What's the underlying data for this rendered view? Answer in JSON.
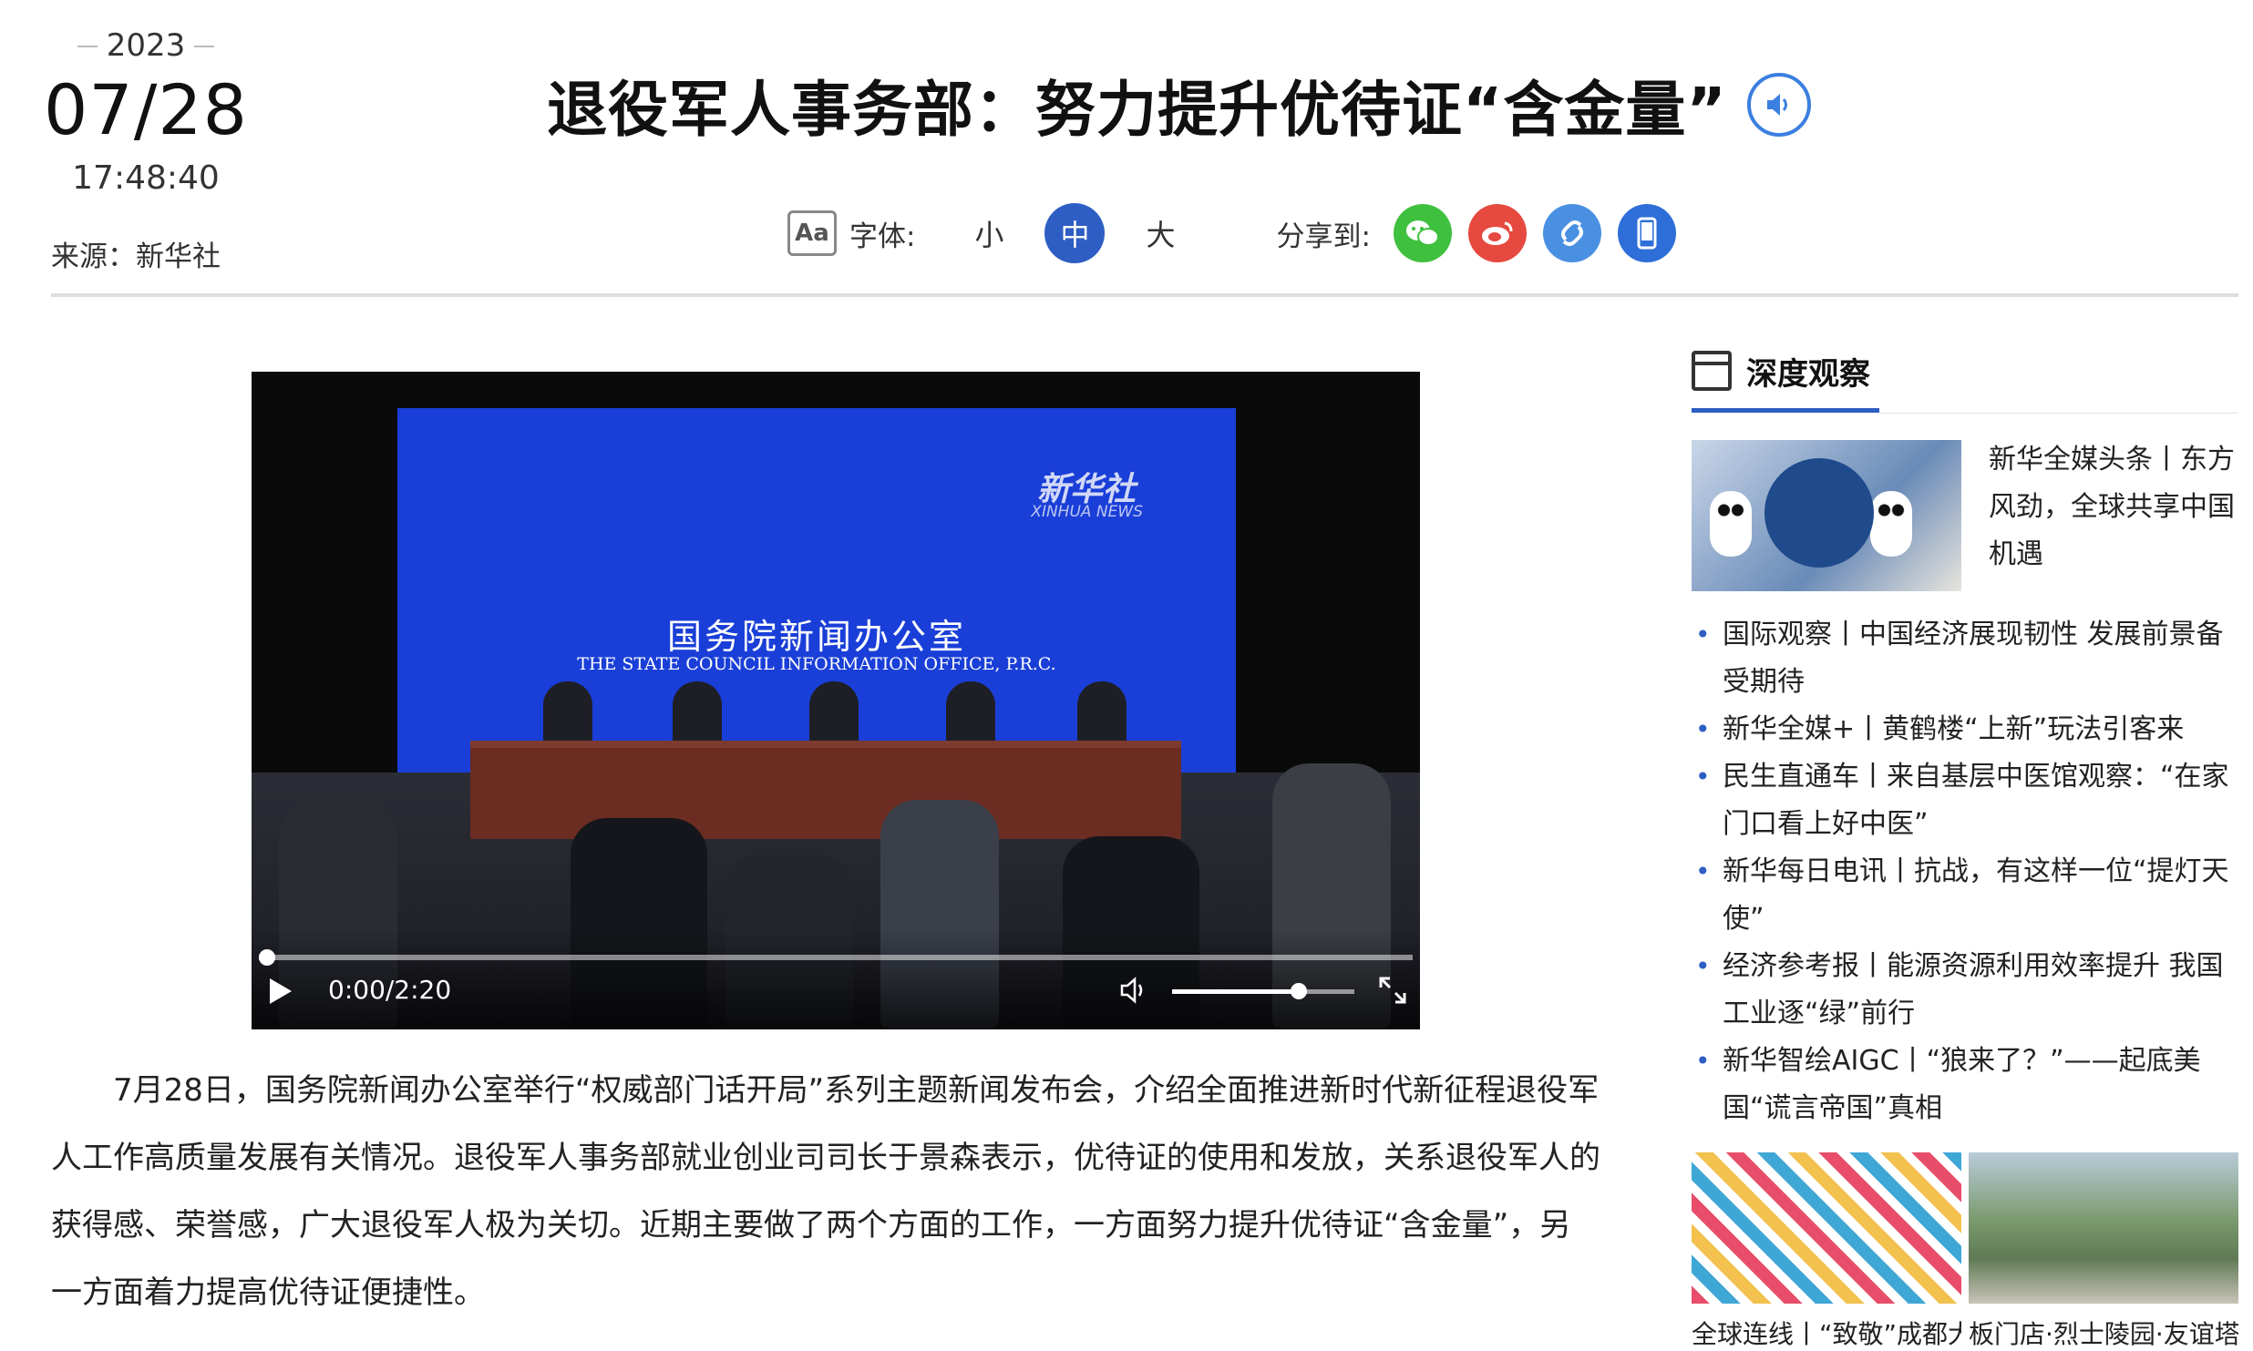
{
  "date": {
    "year": "2023",
    "day": "07/28",
    "time": "17:48:40",
    "source": "来源：新华社"
  },
  "title": "退役军人事务部：努力提升优待证“含金量”",
  "toolbar": {
    "font_label": "字体:",
    "sizes": [
      "小",
      "中",
      "大"
    ],
    "active_size": "中",
    "share_label": "分享到:",
    "share_colors": {
      "wechat": "#3fc03f",
      "weibo": "#e6493f",
      "link": "#4a90e2",
      "mobile": "#2e6ed9"
    }
  },
  "video": {
    "watermark": "新华社",
    "watermark_sub": "XINHUA NEWS",
    "screen_title": "国务院新闻办公室",
    "screen_subtitle": "THE STATE COUNCIL INFORMATION OFFICE, P.R.C.",
    "time_display": "0:00/2:20",
    "progress": 0.0,
    "volume": 0.7
  },
  "article": {
    "paragraph": "7月28日，国务院新闻办公室举行“权威部门话开局”系列主题新闻发布会，介绍全面推进新时代新征程退役军人工作高质量发展有关情况。退役军人事务部就业创业司司长于景森表示，优待证的使用和发放，关系退役军人的获得感、荣誉感，广大退役军人极为关切。近期主要做了两个方面的工作，一方面努力提升优待证“含金量”，另一方面着力提高优待证便捷性。"
  },
  "sidebar": {
    "title": "深度观察",
    "feature_text": "新华全媒头条丨东方风劲，全球共享中国机遇",
    "news": [
      "国际观察丨中国经济展现韧性 发展前景备受期待",
      "新华全媒+丨黄鹤楼“上新”玩法引客来",
      "民生直通车丨来自基层中医馆观察：“在家门口看上好中医”",
      "新华每日电讯丨抗战，有这样一位“提灯天使”",
      "经济参考报丨能源资源利用效率提升 我国工业逐“绿”前行",
      "新华智绘AIGC丨“狼来了？”——起底美国“谎言帝国”真相"
    ],
    "thumbs": [
      {
        "caption": "全球连线丨“致敬”成都大运会"
      },
      {
        "caption": "板门店·烈士陵园·友谊塔"
      }
    ]
  }
}
